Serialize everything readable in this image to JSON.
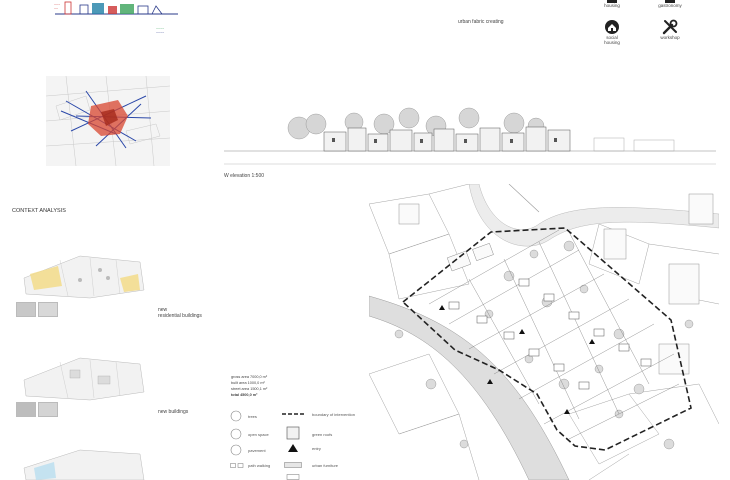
{
  "top_center_label": "urban fabric creating",
  "icons": [
    {
      "name": "social-housing-top-icon",
      "label": "housing"
    },
    {
      "name": "gastronomy-icon",
      "label": "gastronomy"
    },
    {
      "name": "social-housing-icon",
      "label": "social housing"
    },
    {
      "name": "workshop-icon",
      "label": "workshop"
    }
  ],
  "elevation_label": "W elevation 1:500",
  "context_title": "CONTEXT ANALYSIS",
  "phases": [
    {
      "label_line1": "new",
      "label_line2": "residential buildings"
    },
    {
      "label_line1": "new buildings",
      "label_line2": ""
    }
  ],
  "stats": {
    "line1": "gross area 7000,0 m²",
    "line2": "built area 1000,0 m²",
    "line3": "street area 1500,1 m²",
    "line4": "total 4500,0 m²"
  },
  "legend": {
    "items": [
      {
        "label": "boundary of intervention"
      },
      {
        "label": "green roofs"
      },
      {
        "label": "entry"
      },
      {
        "label": "urban furniture"
      },
      {
        "label": "trees"
      },
      {
        "label": "open space"
      },
      {
        "label": "pavement"
      },
      {
        "label": "path walking"
      }
    ]
  }
}
